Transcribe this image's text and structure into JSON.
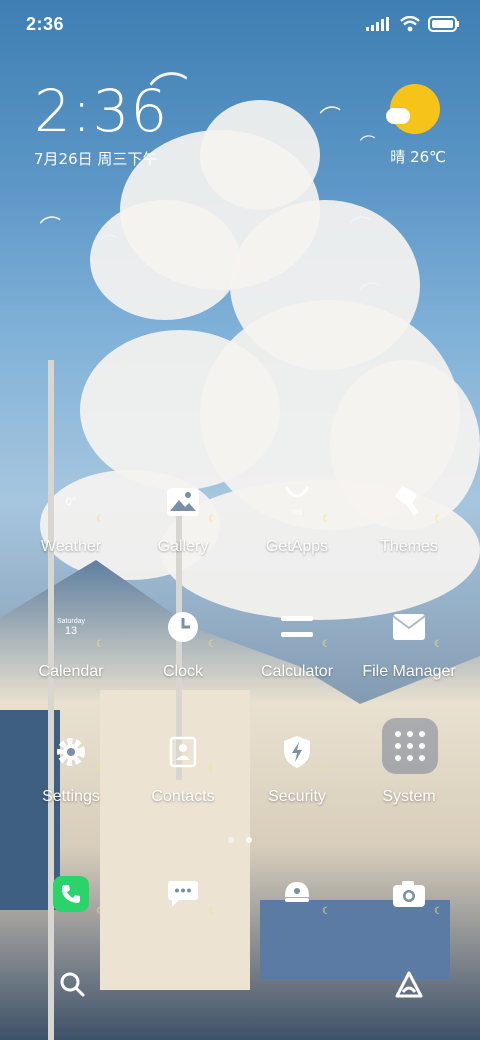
{
  "status_bar": {
    "time": "2:36"
  },
  "clock_widget": {
    "time": "2:36",
    "date": "7月26日 周三下午"
  },
  "weather_widget": {
    "text": "晴 26℃"
  },
  "apps": [
    {
      "name": "weather",
      "label": "Weather",
      "icon": "weather-icon",
      "badge": "0°"
    },
    {
      "name": "gallery",
      "label": "Gallery",
      "icon": "gallery-icon"
    },
    {
      "name": "getapps",
      "label": "GetApps",
      "icon": "getapps-icon"
    },
    {
      "name": "themes",
      "label": "Themes",
      "icon": "themes-icon"
    },
    {
      "name": "calendar",
      "label": "Calendar",
      "icon": "calendar-icon",
      "weekday": "Saturday",
      "day": "13"
    },
    {
      "name": "clock",
      "label": "Clock",
      "icon": "clock-icon"
    },
    {
      "name": "calculator",
      "label": "Calculator",
      "icon": "calculator-icon"
    },
    {
      "name": "file-manager",
      "label": "File Manager",
      "icon": "folder-icon"
    },
    {
      "name": "settings",
      "label": "Settings",
      "icon": "gear-icon"
    },
    {
      "name": "contacts",
      "label": "Contacts",
      "icon": "contacts-icon"
    },
    {
      "name": "security",
      "label": "Security",
      "icon": "shield-icon"
    },
    {
      "name": "system",
      "label": "System",
      "icon": "folder-grid-icon"
    }
  ],
  "dock": [
    {
      "name": "phone",
      "icon": "phone-icon"
    },
    {
      "name": "messages",
      "icon": "messages-icon"
    },
    {
      "name": "browser",
      "icon": "browser-icon"
    },
    {
      "name": "camera",
      "icon": "camera-icon"
    }
  ],
  "page_indicator": {
    "pages": 2,
    "active": 1
  },
  "bottom_bar": {
    "search": "search-icon",
    "assistant": "assistant-icon"
  },
  "colors": {
    "sun": "#f6c31b",
    "phone_green": "#2bd46a",
    "moon": "#f6e27a"
  }
}
